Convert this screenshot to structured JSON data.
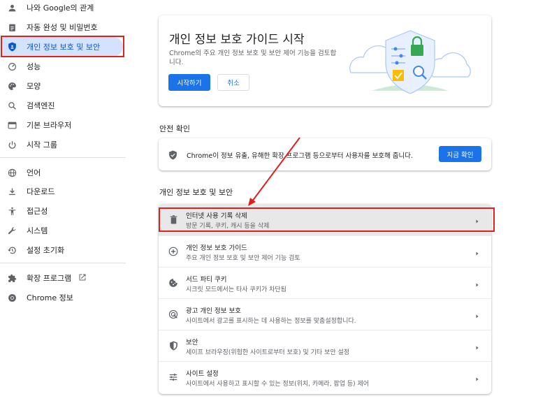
{
  "sidebar": {
    "items": [
      {
        "label": "나와 Google의 관계",
        "icon": "person-icon"
      },
      {
        "label": "자동 완성 및 비밀번호",
        "icon": "clipboard-icon"
      },
      {
        "label": "개인 정보 보호 및 보안",
        "icon": "shield-icon",
        "active": true
      },
      {
        "label": "성능",
        "icon": "speedometer-icon"
      },
      {
        "label": "모양",
        "icon": "palette-icon"
      },
      {
        "label": "검색엔진",
        "icon": "search-icon"
      },
      {
        "label": "기본 브라우저",
        "icon": "browser-icon"
      },
      {
        "label": "시작 그룹",
        "icon": "power-icon"
      },
      {
        "label": "언어",
        "icon": "globe-icon"
      },
      {
        "label": "다운로드",
        "icon": "download-icon"
      },
      {
        "label": "접근성",
        "icon": "accessibility-icon"
      },
      {
        "label": "시스템",
        "icon": "wrench-icon"
      },
      {
        "label": "설정 초기화",
        "icon": "history-icon"
      },
      {
        "label": "확장 프로그램",
        "icon": "puzzle-icon"
      },
      {
        "label": "Chrome 정보",
        "icon": "chrome-icon"
      }
    ]
  },
  "guide_card": {
    "title": "개인 정보 보호 가이드 시작",
    "description": "Chrome의 주요 개인 정보 보호 및 보안 제어 기능을 검토합니다.",
    "start_button": "시작하기",
    "cancel_button": "취소"
  },
  "safety_check": {
    "title": "안전 확인",
    "text": "Chrome이 정보 유출, 유해한 확장 프로그램 등으로부터 사용자를 보호해 줍니다.",
    "button": "지금 확인"
  },
  "privacy_section": {
    "title": "개인 정보 보호 및 보안",
    "rows": [
      {
        "title": "인터넷 사용 기록 삭제",
        "subtitle": "방문 기록, 쿠키, 캐시 등을 삭제",
        "icon": "trash-icon"
      },
      {
        "title": "개인 정보 보호 가이드",
        "subtitle": "주요 개인 정보 보호 및 보안 제어 기능 검토",
        "icon": "compass-plus-icon"
      },
      {
        "title": "서드 파티 쿠키",
        "subtitle": "시크릿 모드에서는 타사 쿠키가 차단됨",
        "icon": "cookie-icon"
      },
      {
        "title": "광고 개인 정보 보호",
        "subtitle": "사이트에서 광고를 표시하는 데 사용하는 정보를 맞춤설정합니다.",
        "icon": "ad-privacy-icon"
      },
      {
        "title": "보안",
        "subtitle": "세이프 브라우징(위험한 사이트로부터 보호) 및 기타 보안 설정",
        "icon": "security-shield-icon"
      },
      {
        "title": "사이트 설정",
        "subtitle": "사이트에서 사용하고 표시할 수 있는 정보(위치, 카메라, 팝업 등) 제어",
        "icon": "sliders-icon"
      }
    ]
  },
  "colors": {
    "accent": "#1a73e8",
    "active_nav_bg": "#d3e3fd",
    "annotation_red": "#e0201c"
  }
}
